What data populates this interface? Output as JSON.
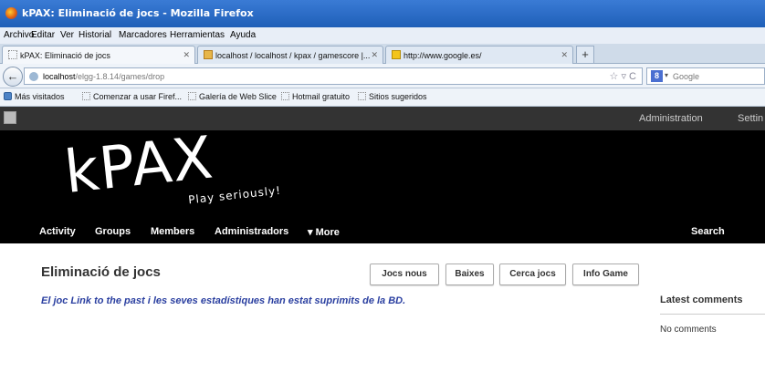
{
  "window": {
    "title": "kPAX: Eliminació de jocs - Mozilla Firefox"
  },
  "menu": [
    "Archivo",
    "Editar",
    "Ver",
    "Historial",
    "Marcadores",
    "Herramientas",
    "Ayuda"
  ],
  "tabs": [
    {
      "label": "kPAX: Eliminació de jocs"
    },
    {
      "label": "localhost / localhost / kpax / gamescore |..."
    },
    {
      "label": "http://www.google.es/"
    }
  ],
  "newtab": "+",
  "address": {
    "host": "localhost",
    "path": "/elgg-1.8.14/games/drop",
    "icons": "☆ ▿ C"
  },
  "search": {
    "placeholder": "Google",
    "engine": "8"
  },
  "bookmarks": [
    "Más visitados",
    "Comenzar a usar Firef...",
    "Galería de Web Slice",
    "Hotmail gratuito",
    "Sitios sugeridos"
  ],
  "topbar": {
    "admin": "Administration",
    "settings": "Settin"
  },
  "site": {
    "logo": "kPAX",
    "tagline": "Play seriously!"
  },
  "nav": [
    "Activity",
    "Groups",
    "Members",
    "Administradors",
    "▾ More",
    "Search"
  ],
  "page": {
    "title": "Eliminació de jocs",
    "buttons": [
      "Jocs nous",
      "Baixes",
      "Cerca jocs",
      "Info Game"
    ],
    "message": "El joc Link to the past i les seves estadístiques han estat suprimits de la BD."
  },
  "sidebar": {
    "title": "Latest comments",
    "empty": "No comments"
  }
}
